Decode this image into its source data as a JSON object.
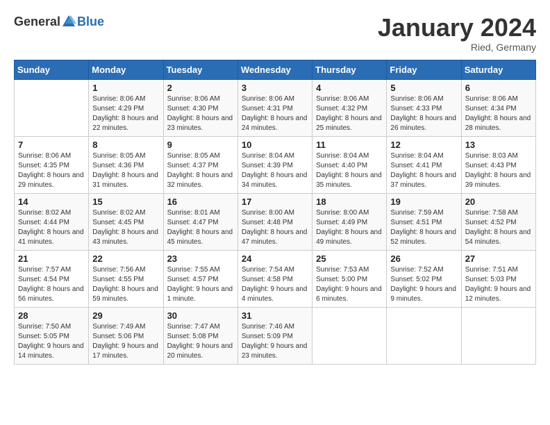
{
  "header": {
    "logo_general": "General",
    "logo_blue": "Blue",
    "month_title": "January 2024",
    "subtitle": "Ried, Germany"
  },
  "days_of_week": [
    "Sunday",
    "Monday",
    "Tuesday",
    "Wednesday",
    "Thursday",
    "Friday",
    "Saturday"
  ],
  "weeks": [
    [
      {
        "day": "",
        "sunrise": "",
        "sunset": "",
        "daylight": ""
      },
      {
        "day": "1",
        "sunrise": "8:06 AM",
        "sunset": "4:29 PM",
        "daylight": "8 hours and 22 minutes."
      },
      {
        "day": "2",
        "sunrise": "8:06 AM",
        "sunset": "4:30 PM",
        "daylight": "8 hours and 23 minutes."
      },
      {
        "day": "3",
        "sunrise": "8:06 AM",
        "sunset": "4:31 PM",
        "daylight": "8 hours and 24 minutes."
      },
      {
        "day": "4",
        "sunrise": "8:06 AM",
        "sunset": "4:32 PM",
        "daylight": "8 hours and 25 minutes."
      },
      {
        "day": "5",
        "sunrise": "8:06 AM",
        "sunset": "4:33 PM",
        "daylight": "8 hours and 26 minutes."
      },
      {
        "day": "6",
        "sunrise": "8:06 AM",
        "sunset": "4:34 PM",
        "daylight": "8 hours and 28 minutes."
      }
    ],
    [
      {
        "day": "7",
        "sunrise": "8:06 AM",
        "sunset": "4:35 PM",
        "daylight": "8 hours and 29 minutes."
      },
      {
        "day": "8",
        "sunrise": "8:05 AM",
        "sunset": "4:36 PM",
        "daylight": "8 hours and 31 minutes."
      },
      {
        "day": "9",
        "sunrise": "8:05 AM",
        "sunset": "4:37 PM",
        "daylight": "8 hours and 32 minutes."
      },
      {
        "day": "10",
        "sunrise": "8:04 AM",
        "sunset": "4:39 PM",
        "daylight": "8 hours and 34 minutes."
      },
      {
        "day": "11",
        "sunrise": "8:04 AM",
        "sunset": "4:40 PM",
        "daylight": "8 hours and 35 minutes."
      },
      {
        "day": "12",
        "sunrise": "8:04 AM",
        "sunset": "4:41 PM",
        "daylight": "8 hours and 37 minutes."
      },
      {
        "day": "13",
        "sunrise": "8:03 AM",
        "sunset": "4:43 PM",
        "daylight": "8 hours and 39 minutes."
      }
    ],
    [
      {
        "day": "14",
        "sunrise": "8:02 AM",
        "sunset": "4:44 PM",
        "daylight": "8 hours and 41 minutes."
      },
      {
        "day": "15",
        "sunrise": "8:02 AM",
        "sunset": "4:45 PM",
        "daylight": "8 hours and 43 minutes."
      },
      {
        "day": "16",
        "sunrise": "8:01 AM",
        "sunset": "4:47 PM",
        "daylight": "8 hours and 45 minutes."
      },
      {
        "day": "17",
        "sunrise": "8:00 AM",
        "sunset": "4:48 PM",
        "daylight": "8 hours and 47 minutes."
      },
      {
        "day": "18",
        "sunrise": "8:00 AM",
        "sunset": "4:49 PM",
        "daylight": "8 hours and 49 minutes."
      },
      {
        "day": "19",
        "sunrise": "7:59 AM",
        "sunset": "4:51 PM",
        "daylight": "8 hours and 52 minutes."
      },
      {
        "day": "20",
        "sunrise": "7:58 AM",
        "sunset": "4:52 PM",
        "daylight": "8 hours and 54 minutes."
      }
    ],
    [
      {
        "day": "21",
        "sunrise": "7:57 AM",
        "sunset": "4:54 PM",
        "daylight": "8 hours and 56 minutes."
      },
      {
        "day": "22",
        "sunrise": "7:56 AM",
        "sunset": "4:55 PM",
        "daylight": "8 hours and 59 minutes."
      },
      {
        "day": "23",
        "sunrise": "7:55 AM",
        "sunset": "4:57 PM",
        "daylight": "9 hours and 1 minute."
      },
      {
        "day": "24",
        "sunrise": "7:54 AM",
        "sunset": "4:58 PM",
        "daylight": "9 hours and 4 minutes."
      },
      {
        "day": "25",
        "sunrise": "7:53 AM",
        "sunset": "5:00 PM",
        "daylight": "9 hours and 6 minutes."
      },
      {
        "day": "26",
        "sunrise": "7:52 AM",
        "sunset": "5:02 PM",
        "daylight": "9 hours and 9 minutes."
      },
      {
        "day": "27",
        "sunrise": "7:51 AM",
        "sunset": "5:03 PM",
        "daylight": "9 hours and 12 minutes."
      }
    ],
    [
      {
        "day": "28",
        "sunrise": "7:50 AM",
        "sunset": "5:05 PM",
        "daylight": "9 hours and 14 minutes."
      },
      {
        "day": "29",
        "sunrise": "7:49 AM",
        "sunset": "5:06 PM",
        "daylight": "9 hours and 17 minutes."
      },
      {
        "day": "30",
        "sunrise": "7:47 AM",
        "sunset": "5:08 PM",
        "daylight": "9 hours and 20 minutes."
      },
      {
        "day": "31",
        "sunrise": "7:46 AM",
        "sunset": "5:09 PM",
        "daylight": "9 hours and 23 minutes."
      },
      {
        "day": "",
        "sunrise": "",
        "sunset": "",
        "daylight": ""
      },
      {
        "day": "",
        "sunrise": "",
        "sunset": "",
        "daylight": ""
      },
      {
        "day": "",
        "sunrise": "",
        "sunset": "",
        "daylight": ""
      }
    ]
  ],
  "labels": {
    "sunrise": "Sunrise:",
    "sunset": "Sunset:",
    "daylight": "Daylight:"
  }
}
